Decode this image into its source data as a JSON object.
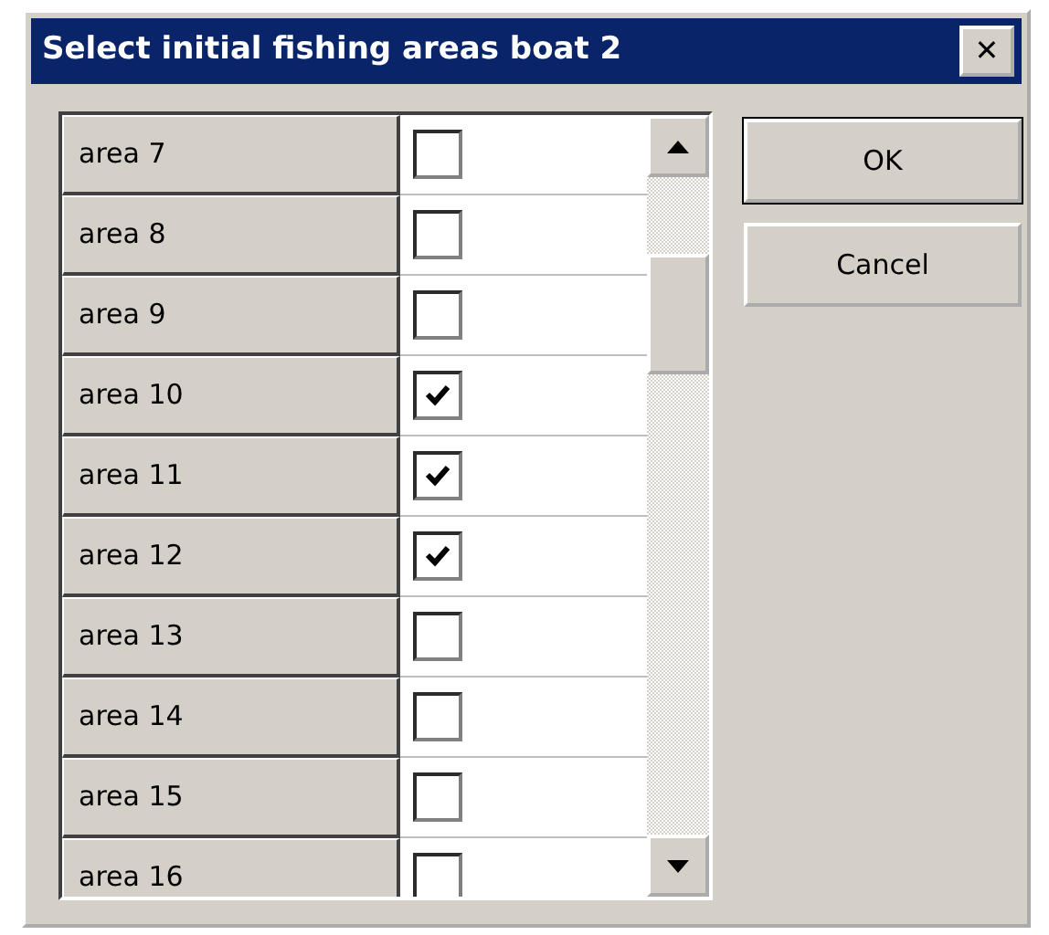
{
  "window": {
    "title": "Select initial fishing areas boat 2",
    "close": "✕"
  },
  "areas": [
    {
      "name": "area 7",
      "checked": false
    },
    {
      "name": "area 8",
      "checked": false
    },
    {
      "name": "area 9",
      "checked": false
    },
    {
      "name": "area 10",
      "checked": true
    },
    {
      "name": "area 11",
      "checked": true
    },
    {
      "name": "area 12",
      "checked": true
    },
    {
      "name": "area 13",
      "checked": false
    },
    {
      "name": "area 14",
      "checked": false
    },
    {
      "name": "area 15",
      "checked": false
    },
    {
      "name": "area 16",
      "checked": false
    }
  ],
  "buttons": [
    "OK",
    "Cancel"
  ]
}
